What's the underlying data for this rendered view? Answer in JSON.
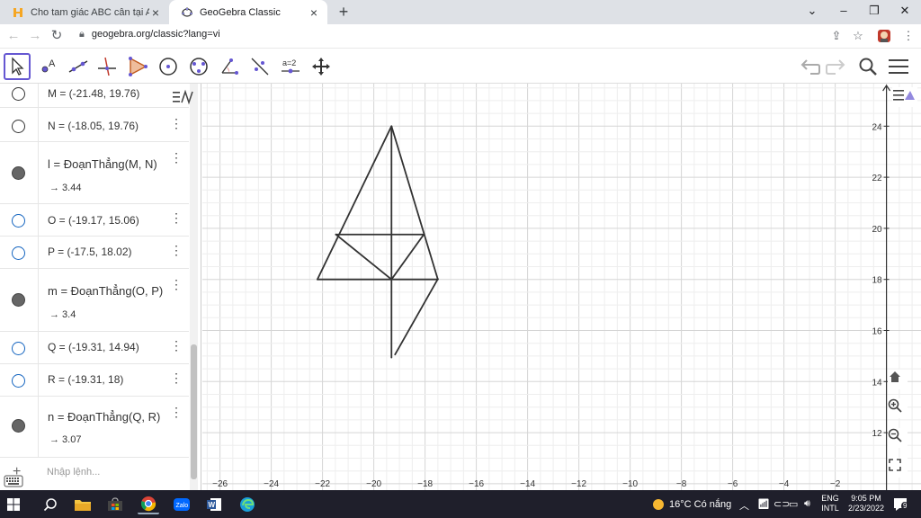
{
  "browser": {
    "tabs": [
      {
        "title": "Cho tam giác ABC cân tại A. Tia p",
        "active": false
      },
      {
        "title": "GeoGebra Classic",
        "active": true
      }
    ],
    "url": "geogebra.org/classic?lang=vi"
  },
  "algebra": {
    "rows": [
      {
        "label": "M = (-21.48, 19.76)",
        "marker": "empty"
      },
      {
        "label": "N = (-18.05, 19.76)",
        "marker": "empty"
      },
      {
        "label": "l = ĐoạnThẳng(M, N)",
        "value": "→ 3.44",
        "marker": "filled"
      },
      {
        "label": "O = (-19.17, 15.06)",
        "marker": "blue"
      },
      {
        "label": "P = (-17.5, 18.02)",
        "marker": "blue"
      },
      {
        "label": "m = ĐoạnThẳng(O, P)",
        "value": "→ 3.4",
        "marker": "filled"
      },
      {
        "label": "Q = (-19.31, 14.94)",
        "marker": "blue"
      },
      {
        "label": "R = (-19.31, 18)",
        "marker": "blue"
      },
      {
        "label": "n = ĐoạnThẳng(Q, R)",
        "value": "→ 3.07",
        "marker": "filled"
      }
    ],
    "input_placeholder": "Nhập lệnh..."
  },
  "graphics": {
    "x_ticks": [
      "−26",
      "−24",
      "−22",
      "−20",
      "−18",
      "−16",
      "−14",
      "−12",
      "−10",
      "−8",
      "−6",
      "−4",
      "−2"
    ],
    "y_ticks": [
      "24",
      "22",
      "20",
      "18",
      "16",
      "14",
      "12"
    ]
  },
  "taskbar": {
    "weather": "16°C  Có nắng",
    "lang_top": "ENG",
    "lang_bottom": "INTL",
    "time": "9:05 PM",
    "date": "2/23/2022",
    "notif_count": "9"
  }
}
